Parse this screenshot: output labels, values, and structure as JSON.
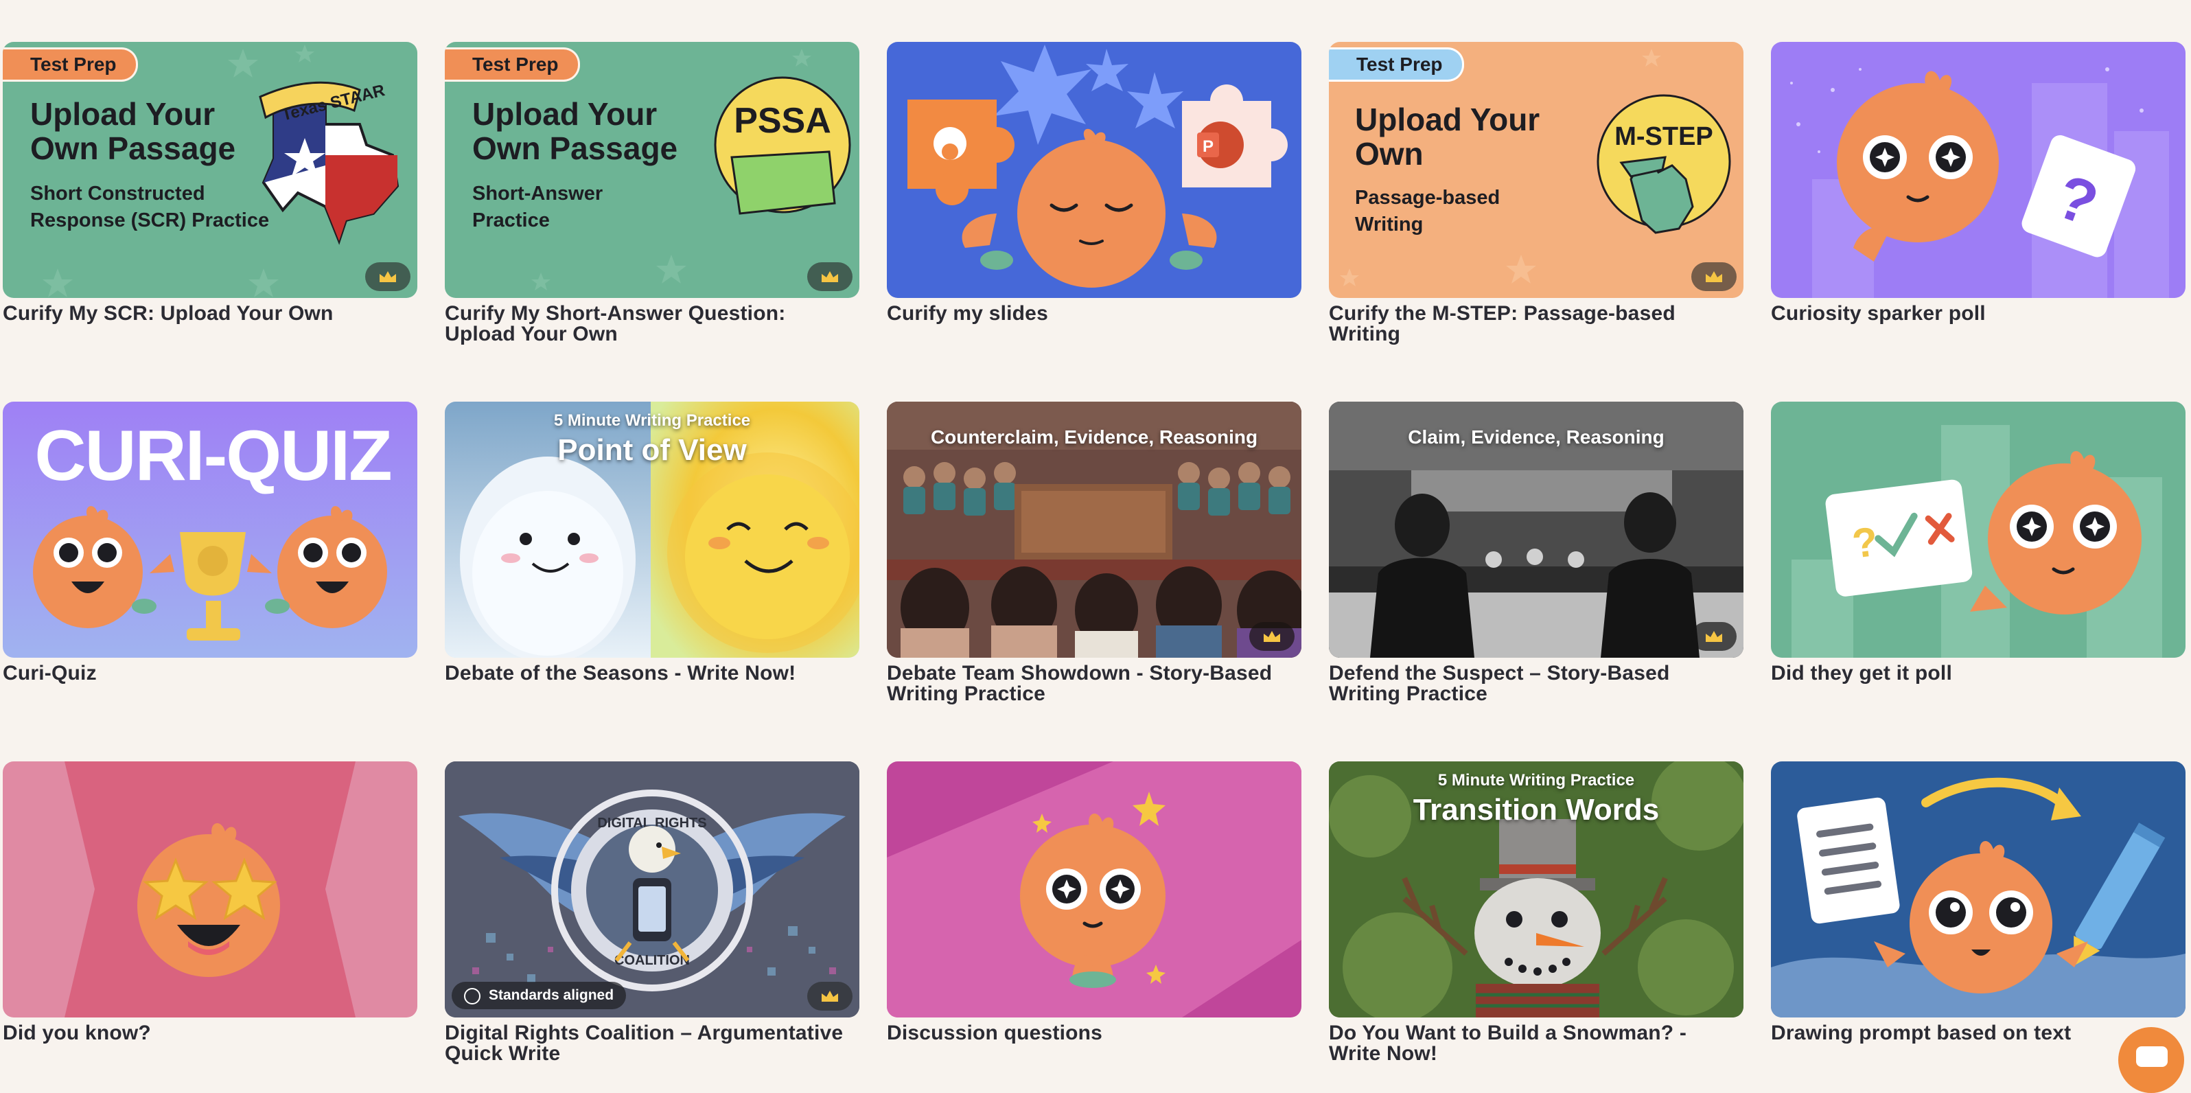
{
  "cards": [
    {
      "title": "Curify My SCR: Upload Your Own",
      "badge": "Test Prep",
      "line1": "Upload Your",
      "line2": "Own Passage",
      "sub1": "Short Constructed",
      "sub2": "Response (SCR) Practice",
      "state_label": "Texas STAAR"
    },
    {
      "title": "Curify My Short-Answer Question: Upload Your Own",
      "badge": "Test Prep",
      "line1": "Upload Your",
      "line2": "Own Passage",
      "sub1": "Short-Answer",
      "sub2": "Practice",
      "state_label": "PSSA"
    },
    {
      "title": "Curify my slides"
    },
    {
      "title": "Curify the M-STEP: Passage-based Writing",
      "badge": "Test Prep",
      "line1": "Upload Your",
      "line2": "Own",
      "sub1": "Passage-based",
      "sub2": "Writing",
      "state_label": "M-STEP"
    },
    {
      "title": "Curiosity sparker poll"
    },
    {
      "title": "Curi-Quiz",
      "banner": "CURI-QUIZ"
    },
    {
      "title": "Debate of the Seasons - Write Now!",
      "small": "5 Minute Writing Practice",
      "big": "Point of View"
    },
    {
      "title": "Debate Team Showdown - Story-Based Writing Practice",
      "big": "Counterclaim, Evidence, Reasoning"
    },
    {
      "title": "Defend the Suspect – Story-Based Writing Practice",
      "big": "Claim, Evidence, Reasoning"
    },
    {
      "title": "Did they get it poll"
    },
    {
      "title": "Did you know?"
    },
    {
      "title": "Digital Rights Coalition – Argumentative Quick Write",
      "seal_top": "DIGITAL RIGHTS",
      "seal_bottom": "COALITION",
      "tag": "Standards aligned"
    },
    {
      "title": "Discussion questions"
    },
    {
      "title": "Do You Want to Build a Snowman? - Write Now!",
      "small": "5 Minute Writing Practice",
      "big": "Transition Words"
    },
    {
      "title": "Drawing prompt based on text"
    }
  ],
  "icons": {
    "crown": "crown-icon",
    "powerpoint": "powerpoint-icon",
    "check": "check-icon"
  },
  "colors": {
    "page_bg": "#f8f3ee",
    "mascot": "#f08f56",
    "test_prep_green": "#6ab293",
    "accent_purple": "#9d7df5",
    "slides_blue": "#4668d8"
  }
}
